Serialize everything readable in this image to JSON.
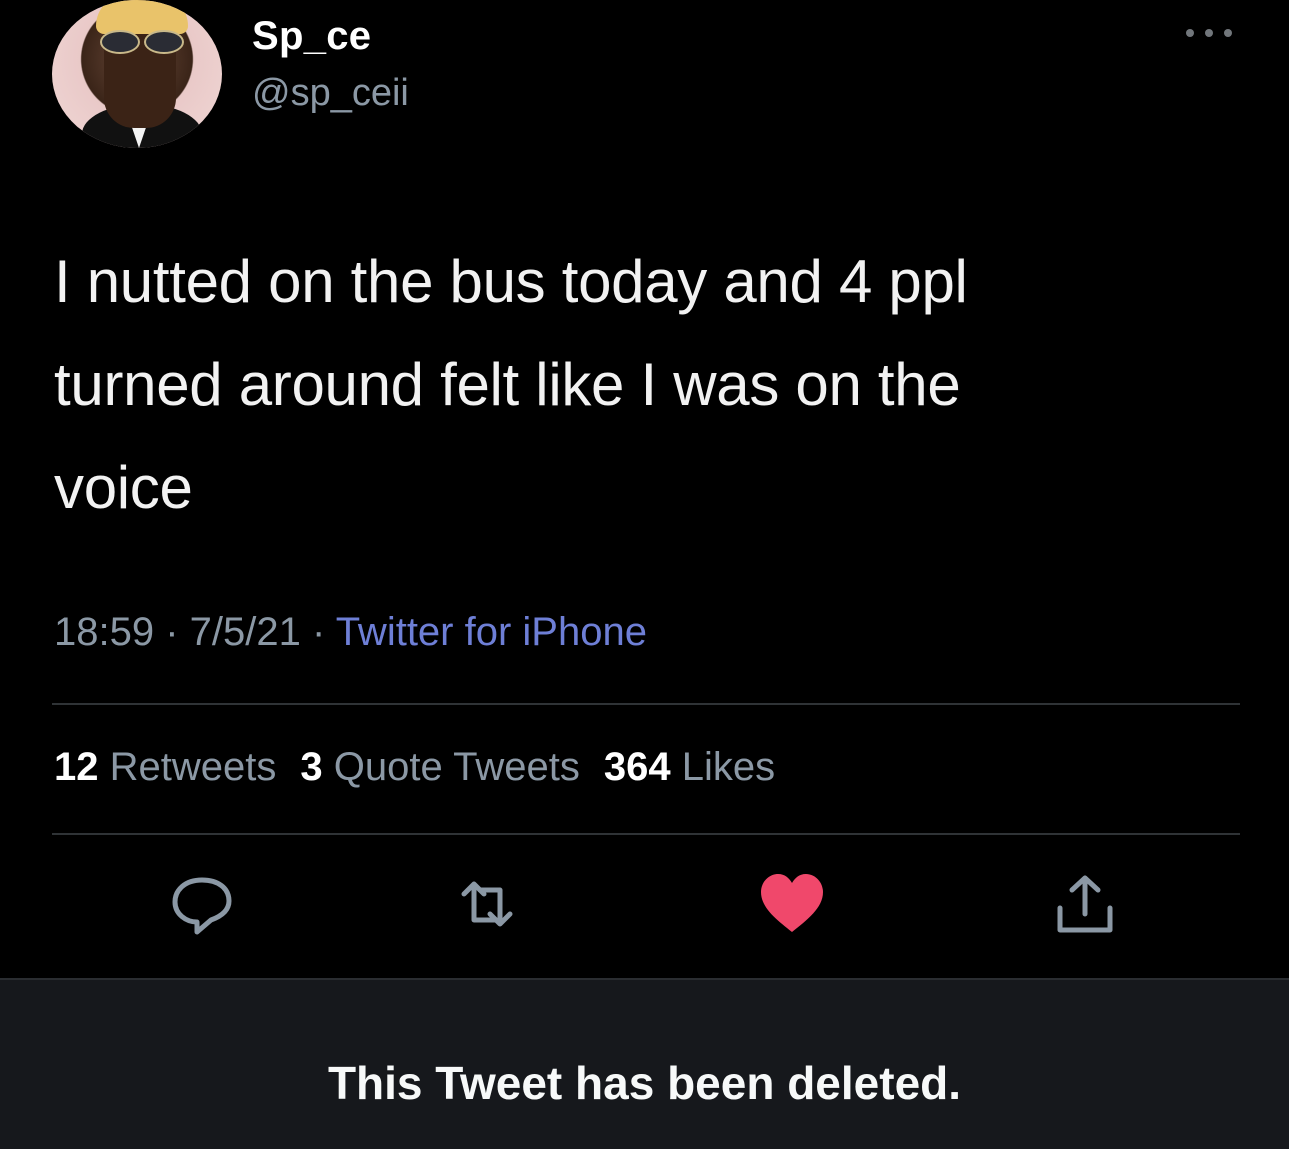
{
  "tweet": {
    "display_name": "Sp_ce",
    "handle": "@sp_ceii",
    "text_lines": [
      "I nutted on the bus today and 4 ppl",
      "turned around felt like I was on the",
      "voice"
    ],
    "time": "18:59",
    "date": "7/5/21",
    "separator": " · ",
    "source": "Twitter for iPhone",
    "stats": {
      "retweets_count": "12",
      "retweets_label": "Retweets",
      "quotes_count": "3",
      "quotes_label": "Quote Tweets",
      "likes_count": "364",
      "likes_label": "Likes"
    },
    "icons": {
      "more": "more-horizontal-icon",
      "reply": "reply-icon",
      "retweet": "retweet-icon",
      "like": "heart-icon",
      "share": "share-icon"
    },
    "like_color": "#f91880",
    "icon_color": "#8b98a5"
  },
  "banner": {
    "message": "This Tweet has been deleted."
  },
  "colors": {
    "background": "#000000",
    "source_link": "#6e7fd6",
    "banner_background": "#16181c"
  }
}
